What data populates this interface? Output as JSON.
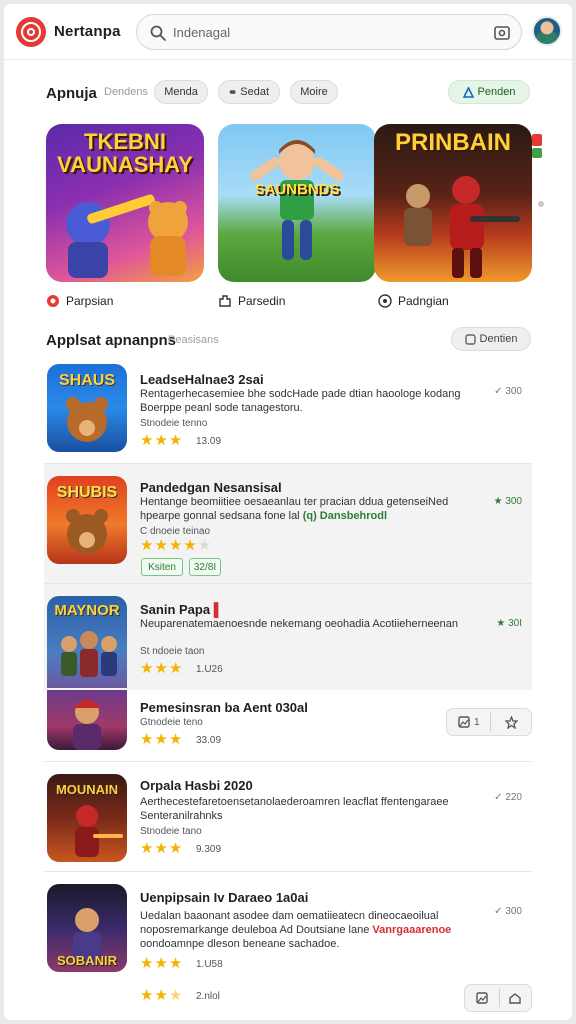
{
  "app": {
    "name": "Nertanpa"
  },
  "search": {
    "placeholder": "Indenagal"
  },
  "filters": {
    "section_label": "Apnuja",
    "sub_label": "Dendens",
    "chips": [
      "Menda",
      "Sedat",
      "Moire"
    ],
    "action_chip": "Penden"
  },
  "featured": [
    {
      "title": "TKEBNI VAUNASHAY",
      "caption": "Parpsian",
      "icon": "brand-icon"
    },
    {
      "title": "SAUNBNDS",
      "caption": "Parsedin",
      "icon": "puzzle-icon"
    },
    {
      "title": "PRINBAIN",
      "caption": "Padngian",
      "icon": "gamepad-icon"
    }
  ],
  "list": {
    "title": "Applsat apnanpns",
    "sub": "Peasisans",
    "button": "Dentien"
  },
  "apps": [
    {
      "thumb_title": "SHAUS",
      "title": "LeadseHalnae3 2sai",
      "desc": "Rentagerhecasemiee bhe sodcHade pade dtian haoologe kodang Boerppe peanl sode tanagestoru.",
      "meta": "Stnodeie tenno",
      "rating": 3,
      "count": "13.09",
      "side": "300"
    },
    {
      "thumb_title": "SHUBIS",
      "title": "Pandedgan Nesansisal",
      "desc": "Hentange beomiitiee oesaeanlau ter pracian ddua getenseiNed hpearpe gonnal sedsana fone lal",
      "desc_hl": "(q) Dansbehrodl",
      "meta": "C dnoeie teinao",
      "rating": 4.5,
      "count": "",
      "tags": [
        "Ksiten",
        "32/8I"
      ],
      "side": "300"
    },
    {
      "thumb_title": "MAYNOR",
      "title": "Sanin Papa",
      "desc": "Neuparenatemaenoesnde nekemang oeohadia Acotiieherneenan",
      "meta": "St ndoeie taon",
      "rating": 3,
      "count": "1.U26",
      "side": "30I"
    },
    {
      "thumb_title": "",
      "title": "Pemesinsran ba Aent 030al",
      "desc": "",
      "meta": "Gtnodeie teno",
      "rating": 3,
      "count": "33.09",
      "actions": [
        "1",
        ""
      ],
      "side": ""
    },
    {
      "thumb_title": "MOUNAIN",
      "title": "Orpala Hasbi 2020",
      "desc": "Aerthecestefaretoensetanolaederoamren leacflat ffentengaraee Senteranilrahnks",
      "meta": "Stnodeie tano",
      "rating": 3,
      "count": "9.309",
      "side": "220"
    },
    {
      "thumb_title": "SOBANIR",
      "title": "Uenpipsain Iv Daraeo 1a0ai",
      "desc": "Uedalan baaonant asodee dam oematiieatecn dineocaeoilual noposremarkange deuleboa Ad Doutsiane lane",
      "desc_hl": "Vanrgaaarenoe",
      "desc_tail": "oondoamnpe dleson beneane sachadoe.",
      "meta": "",
      "rating": 3,
      "count": "1.U58",
      "side": "300"
    }
  ],
  "bottom": {
    "rating": 2.5,
    "count": "2.nlol"
  }
}
